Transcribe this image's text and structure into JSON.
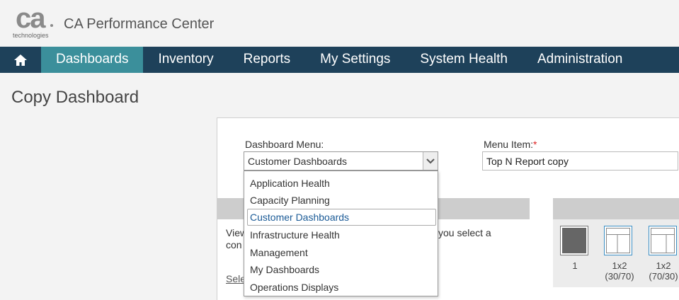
{
  "header": {
    "logo_text": "ca",
    "logo_sub": "technologies",
    "app_title": "CA Performance Center"
  },
  "nav": {
    "home_icon": "home-icon",
    "items": [
      {
        "label": "Dashboards",
        "active": true
      },
      {
        "label": "Inventory",
        "active": false
      },
      {
        "label": "Reports",
        "active": false
      },
      {
        "label": "My Settings",
        "active": false
      },
      {
        "label": "System Health",
        "active": false
      },
      {
        "label": "Administration",
        "active": false
      }
    ]
  },
  "page": {
    "title": "Copy Dashboard"
  },
  "form": {
    "dashboard_menu_label": "Dashboard Menu:",
    "dashboard_menu_value": "Customer Dashboards",
    "menu_item_label": "Menu Item:",
    "required_mark": "*",
    "menu_item_value": "Top N Report copy"
  },
  "dropdown": {
    "options": [
      "Application Health",
      "Capacity Planning",
      "Customer Dashboards",
      "Infrastructure Health",
      "Management",
      "My Dashboards",
      "Operations Displays"
    ],
    "selected": "Customer Dashboards"
  },
  "content": {
    "text_left_line1": "View",
    "text_left_line2": "con",
    "text_right": "you select a",
    "link_partial": "Sele"
  },
  "layouts": {
    "tiles": [
      {
        "label": "1"
      },
      {
        "label": "1x2",
        "sublabel": "(30/70)"
      },
      {
        "label": "1x2",
        "sublabel": "(70/30)"
      }
    ]
  },
  "colors": {
    "nav_bg": "#1e415a",
    "nav_active": "#3b8f9b",
    "selected_text": "#1a5a96",
    "required": "#dd2222"
  }
}
